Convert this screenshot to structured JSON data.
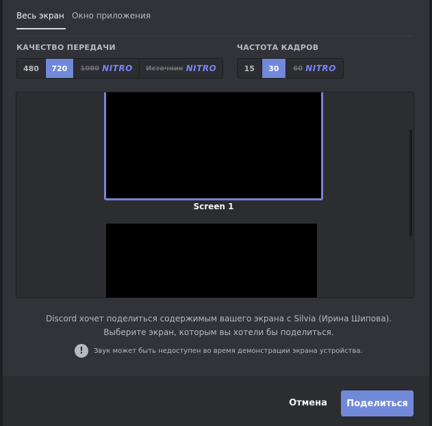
{
  "tabs": [
    {
      "label": "Весь экран"
    },
    {
      "label": "Окно приложения"
    }
  ],
  "quality": {
    "label": "КАЧЕСТВО ПЕРЕДАЧИ",
    "options": [
      {
        "label": "480"
      },
      {
        "label": "720"
      },
      {
        "label": "1080",
        "badge": "NITRO"
      },
      {
        "label": "Источник",
        "badge": "NITRO"
      }
    ],
    "selected": "720"
  },
  "fps": {
    "label": "ЧАСТОТА КАДРОВ",
    "options": [
      {
        "label": "15"
      },
      {
        "label": "30"
      },
      {
        "label": "60",
        "badge": "NITRO"
      }
    ],
    "selected": "30"
  },
  "screens": [
    {
      "label": "Screen 1"
    },
    {
      "label": ""
    }
  ],
  "info": {
    "line1": "Discord хочет поделиться содержимым вашего экрана с Silvia (Ирина Шипова).",
    "line2": "Выберите экран, которым вы хотели бы поделиться.",
    "warning": "Звук может быть недоступен во время демонстрации экрана устройства."
  },
  "footer": {
    "cancel_label": "Отмена",
    "share_label": "Поделиться"
  },
  "colors": {
    "accent": "#7289da",
    "nitro": "#7983f5",
    "background": "#313338"
  }
}
